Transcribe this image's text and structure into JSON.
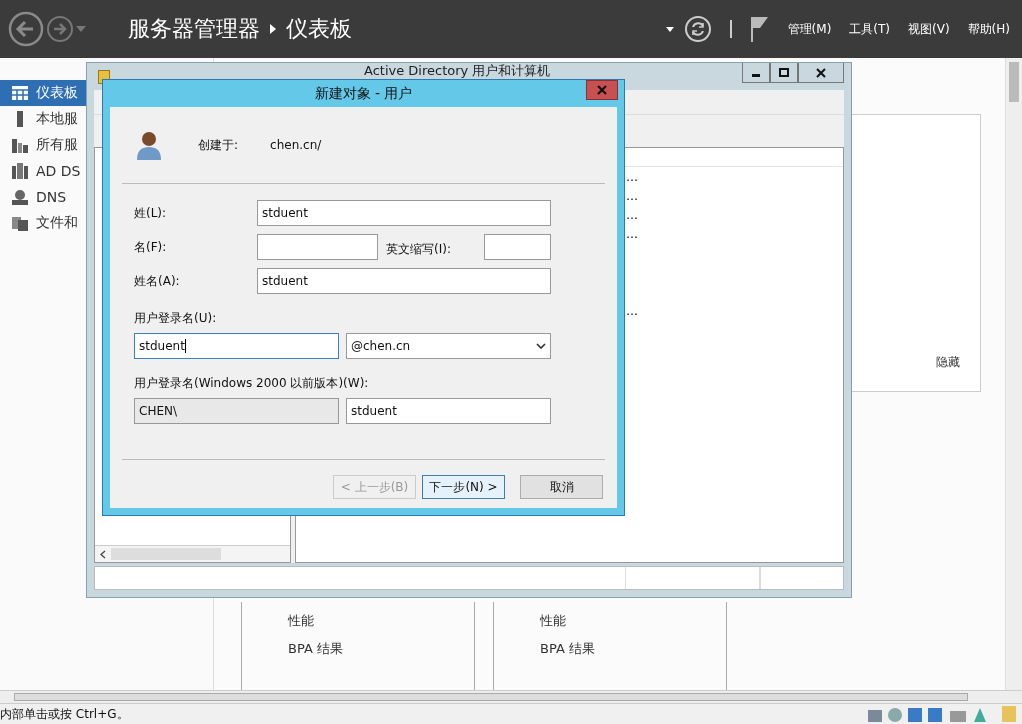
{
  "header": {
    "breadcrumb": [
      "服务器管理器",
      "仪表板"
    ],
    "menus": [
      "管理(M)",
      "工具(T)",
      "视图(V)",
      "帮助(H)"
    ]
  },
  "sidebar": {
    "items": [
      {
        "label": "仪表板",
        "kind": "dashboard",
        "selected": true
      },
      {
        "label": "本地服",
        "kind": "server",
        "selected": false
      },
      {
        "label": "所有服",
        "kind": "servers",
        "selected": false
      },
      {
        "label": "AD DS",
        "kind": "ad",
        "selected": false
      },
      {
        "label": "DNS",
        "kind": "dns",
        "selected": false
      },
      {
        "label": "文件和",
        "kind": "files",
        "selected": false
      }
    ]
  },
  "side_panel": {
    "link": "隐藏"
  },
  "tiles": [
    {
      "lines": [
        "性能",
        "BPA 结果"
      ]
    },
    {
      "lines": [
        "性能",
        "BPA 结果"
      ]
    }
  ],
  "status_bar": {
    "text": "内部单击或按 Ctrl+G。"
  },
  "ad_window": {
    "title": "Active Directory 用户和计算机",
    "rows": [
      "…",
      "…",
      "…",
      "…",
      "…"
    ]
  },
  "dialog": {
    "title": "新建对象 - 用户",
    "created_label": "创建于:",
    "created_value": "chen.cn/",
    "last_name": {
      "label": "姓(L):",
      "value": "stduent"
    },
    "first_name": {
      "label": "名(F):"
    },
    "initials": {
      "label": "英文缩写(I):"
    },
    "full_name": {
      "label": "姓名(A):",
      "value": "stduent"
    },
    "logon": {
      "label": "用户登录名(U):",
      "value": "stduent",
      "focused": true,
      "domain": "@chen.cn"
    },
    "legacy": {
      "label": "用户登录名(Windows 2000 以前版本)(W):",
      "prefix": "CHEN\\",
      "value": "stduent"
    },
    "buttons": [
      {
        "label": "< 上一步(B)",
        "disabled": true,
        "default": false
      },
      {
        "label": "下一步(N) >",
        "disabled": false,
        "default": true
      },
      {
        "label": "取消",
        "disabled": false,
        "default": false
      }
    ]
  }
}
